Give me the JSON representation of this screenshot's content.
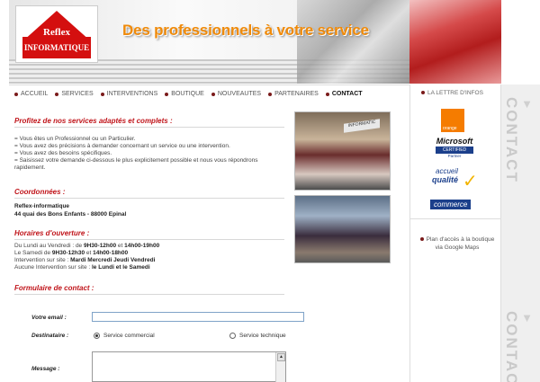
{
  "logo": {
    "line1": "Reflex",
    "line2": "INFORMATIQUE"
  },
  "header": {
    "slogan": "Des professionnels à votre service"
  },
  "nav": [
    {
      "label": "ACCUEIL",
      "active": false
    },
    {
      "label": "SERVICES",
      "active": false
    },
    {
      "label": "INTERVENTIONS",
      "active": false
    },
    {
      "label": "BOUTIQUE",
      "active": false
    },
    {
      "label": "NOUVEAUTES",
      "active": false
    },
    {
      "label": "PARTENAIRES",
      "active": false
    },
    {
      "label": "CONTACT",
      "active": true
    }
  ],
  "sidebar": {
    "newsletter": "LA LETTRE D'INFOS",
    "orange": "orange",
    "microsoft": {
      "brand": "Microsoft",
      "cert": "CERTIFIED",
      "partner": "Partner"
    },
    "accueil_qualite": {
      "l1": "accueil",
      "l2": "qualité",
      "l3": "commerce"
    },
    "maps_link": "Plan d'accès à la boutique via Google Maps"
  },
  "contact_tab": "CONTACT",
  "intro": {
    "title": "Profitez de nos services adaptés et complets :",
    "lines": [
      "= Vous êtes un Professionnel ou un Particulier.",
      "= Vous avez des précisions à demander concernant un service ou une intervention.",
      "= Vous avez des besoins spécifiques.",
      "= Saisissez votre demande ci-dessous le plus explicitement possible et nous vous répondrons",
      "rapidement."
    ]
  },
  "coords": {
    "title": "Coordonnées :",
    "name": "Reflex-informatique",
    "address": "44 quai des Bons Enfants - 88000 Epinal"
  },
  "hours": {
    "title": "Horaires d'ouverture :",
    "l1_pre": "Du Lundi au Vendredi : de ",
    "l1_b1": "9H30-12h00",
    "l1_mid": " et ",
    "l1_b2": "14h00-19h00",
    "l2_pre": "Le Samedi de ",
    "l2_b1": "9H30-12h30",
    "l2_mid": " et ",
    "l2_b2": "14h00-18h00",
    "l3_pre": "Intervention sur site : ",
    "l3_b": "Mardi Mercredi Jeudi Vendredi",
    "l4_pre": "Aucune Intervention sur site : ",
    "l4_b": "le Lundi et le Samedi"
  },
  "photos": {
    "shop_sign": "INFORMATIC"
  },
  "form": {
    "title": "Formulaire de contact :",
    "email_label": "Votre email :",
    "email_value": "",
    "dest_label": "Destinataire :",
    "dest_options": [
      {
        "label": "Service commercial",
        "selected": true
      },
      {
        "label": "Service technique",
        "selected": false
      }
    ],
    "message_label": "Message :"
  },
  "colors": {
    "accent": "#c0141a",
    "slogan": "#ef8a0a",
    "logo": "#d40f0f"
  }
}
